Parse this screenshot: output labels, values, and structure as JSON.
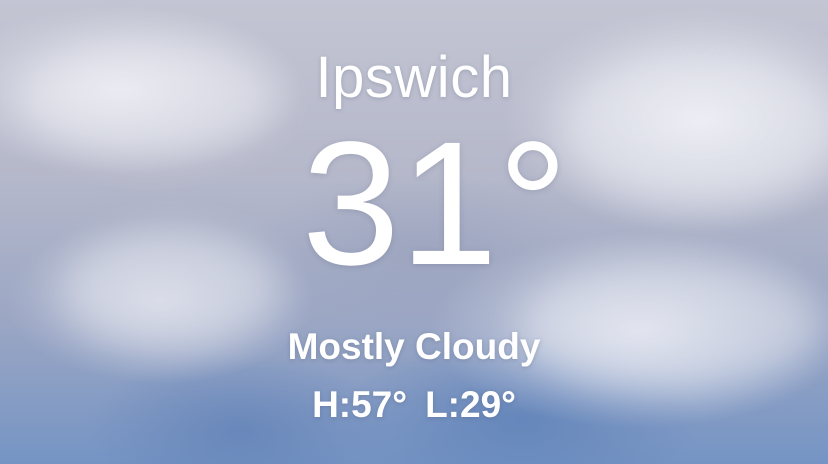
{
  "location": {
    "city": "Ipswich"
  },
  "current": {
    "temperature": "31°",
    "condition": "Mostly Cloudy",
    "high": "H:57°",
    "low": "L:29°"
  },
  "colors": {
    "text": "#ffffff",
    "sky_top": "#c3c5d3",
    "sky_bottom": "#7594c4"
  }
}
